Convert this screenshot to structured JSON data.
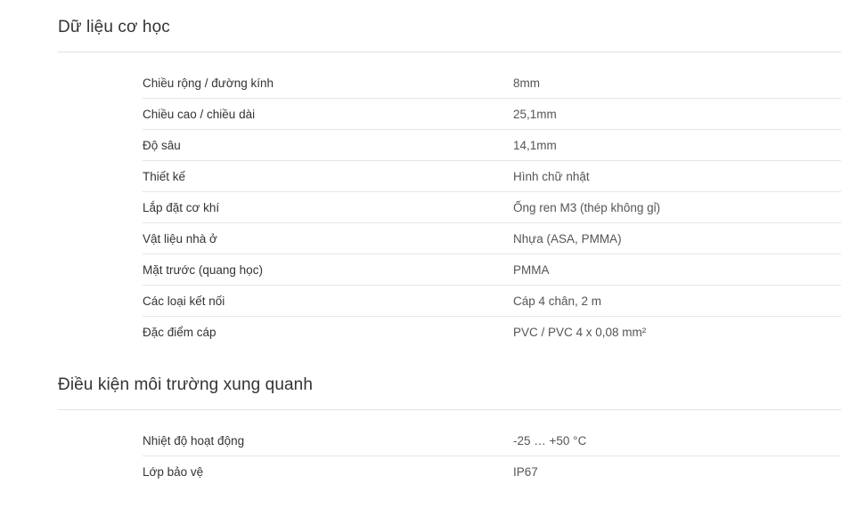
{
  "mechanical": {
    "title": "Dữ liệu cơ học",
    "rows": [
      {
        "label": "Chiều rộng / đường kính",
        "value": "8mm"
      },
      {
        "label": "Chiều cao / chiều dài",
        "value": "25,1mm"
      },
      {
        "label": "Độ sâu",
        "value": "14,1mm"
      },
      {
        "label": "Thiết kế",
        "value": "Hình chữ nhật"
      },
      {
        "label": "Lắp đặt cơ khí",
        "value": "Ống ren M3 (thép không gỉ)"
      },
      {
        "label": "Vật liệu nhà ở",
        "value": "Nhựa (ASA, PMMA)"
      },
      {
        "label": "Mặt trước (quang học)",
        "value": "PMMA"
      },
      {
        "label": "Các loại kết nối",
        "value": "Cáp 4 chân, 2 m"
      },
      {
        "label": "Đặc điểm cáp",
        "value": "PVC / PVC 4 x 0,08 mm²"
      }
    ]
  },
  "ambient": {
    "title": "Điều kiện môi trường xung quanh",
    "rows": [
      {
        "label": "Nhiệt độ hoạt động",
        "value": "-25 … +50 °C"
      },
      {
        "label": "Lớp bảo vệ",
        "value": "IP67"
      }
    ]
  }
}
